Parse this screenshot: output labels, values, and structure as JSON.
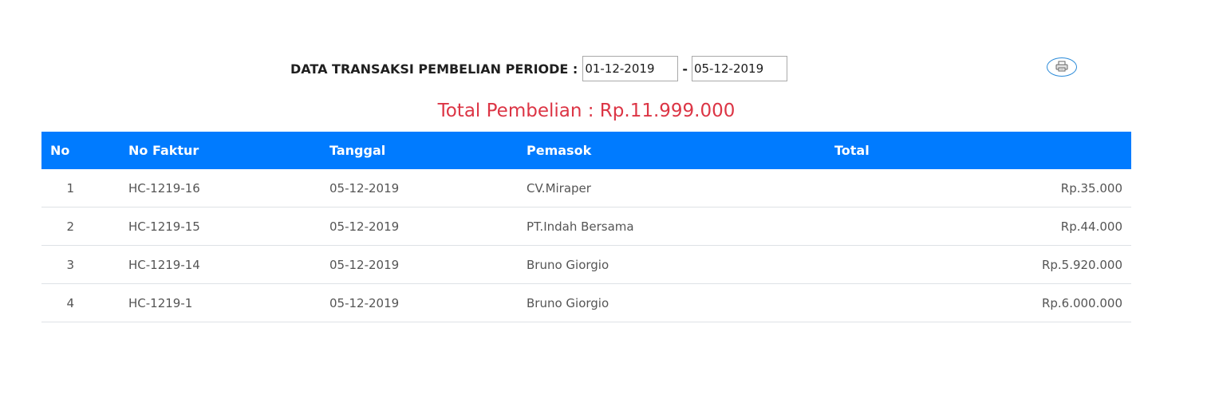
{
  "filter": {
    "title": "DATA TRANSAKSI PEMBELIAN PERIODE :",
    "start_date": "01-12-2019",
    "separator": "-",
    "end_date": "05-12-2019"
  },
  "print_button": {
    "icon": "printer-icon"
  },
  "summary": {
    "total_text": "Total Pembelian : Rp.11.999.000"
  },
  "table": {
    "headers": [
      "No",
      "No Faktur",
      "Tanggal",
      "Pemasok",
      "Total"
    ],
    "rows": [
      [
        "1",
        "HC-1219-16",
        "05-12-2019",
        "CV.Miraper",
        "Rp.35.000"
      ],
      [
        "2",
        "HC-1219-15",
        "05-12-2019",
        "PT.Indah Bersama",
        "Rp.44.000"
      ],
      [
        "3",
        "HC-1219-14",
        "05-12-2019",
        "Bruno Giorgio",
        "Rp.5.920.000"
      ],
      [
        "4",
        "HC-1219-1",
        "05-12-2019",
        "Bruno Giorgio",
        "Rp.6.000.000"
      ]
    ]
  },
  "colors": {
    "header_bg": "#007bff",
    "total_text": "#dc3545",
    "print_border": "#2a8ad8"
  }
}
